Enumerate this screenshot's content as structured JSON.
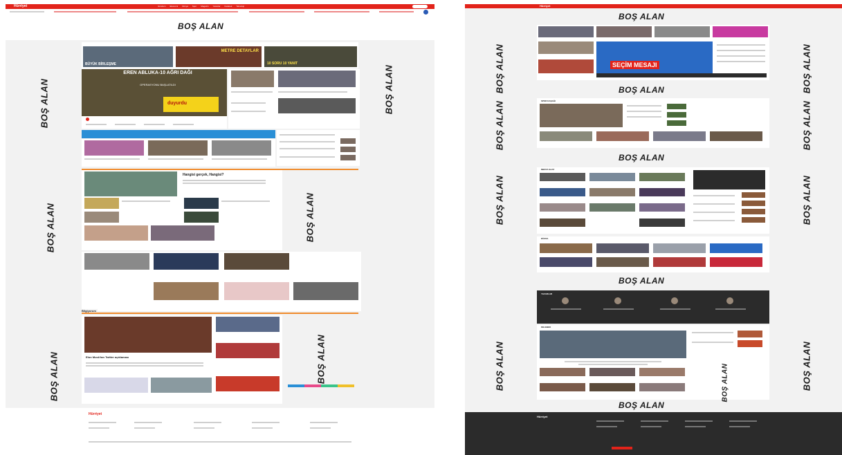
{
  "ad_label": "BOŞ ALAN",
  "left_page": {
    "logo": "Hürriyet",
    "nav_items": [
      "Gündem",
      "Ekonomi",
      "Dünya",
      "Spor",
      "Magazin",
      "Yazarlar",
      "Kelebek",
      "Teknoloji"
    ],
    "headline_badges": [
      "BÜYÜK BİRLEŞME",
      "METRE DETAYLAR",
      "10 SORU 10 YANIT"
    ],
    "main_headline": "EREN ABLUKA-10 AĞRI DAĞI",
    "main_subline": "OPERASYONU BAŞLATILDI",
    "promo_text": "duyurdu",
    "section_title_2": "Hangisi gerçek, Hangisi?",
    "section_title_3": "Bilgiyorum",
    "feature_headline": "Elon Musk'tan Twitter açıklaması"
  },
  "right_page": {
    "logo": "Hürriyet",
    "banner_text": "SEÇİM MESAJI",
    "section_1": "SPOR KAŞAĞI",
    "section_2": "MEDYA SAAT",
    "section_3": "DÜNYA",
    "section_4": "YAZARLAR",
    "section_5": "KELEBEK"
  },
  "colors": {
    "accent": "#e2231a",
    "dark": "#2b2b2b",
    "panel": "#f2f2f2"
  }
}
